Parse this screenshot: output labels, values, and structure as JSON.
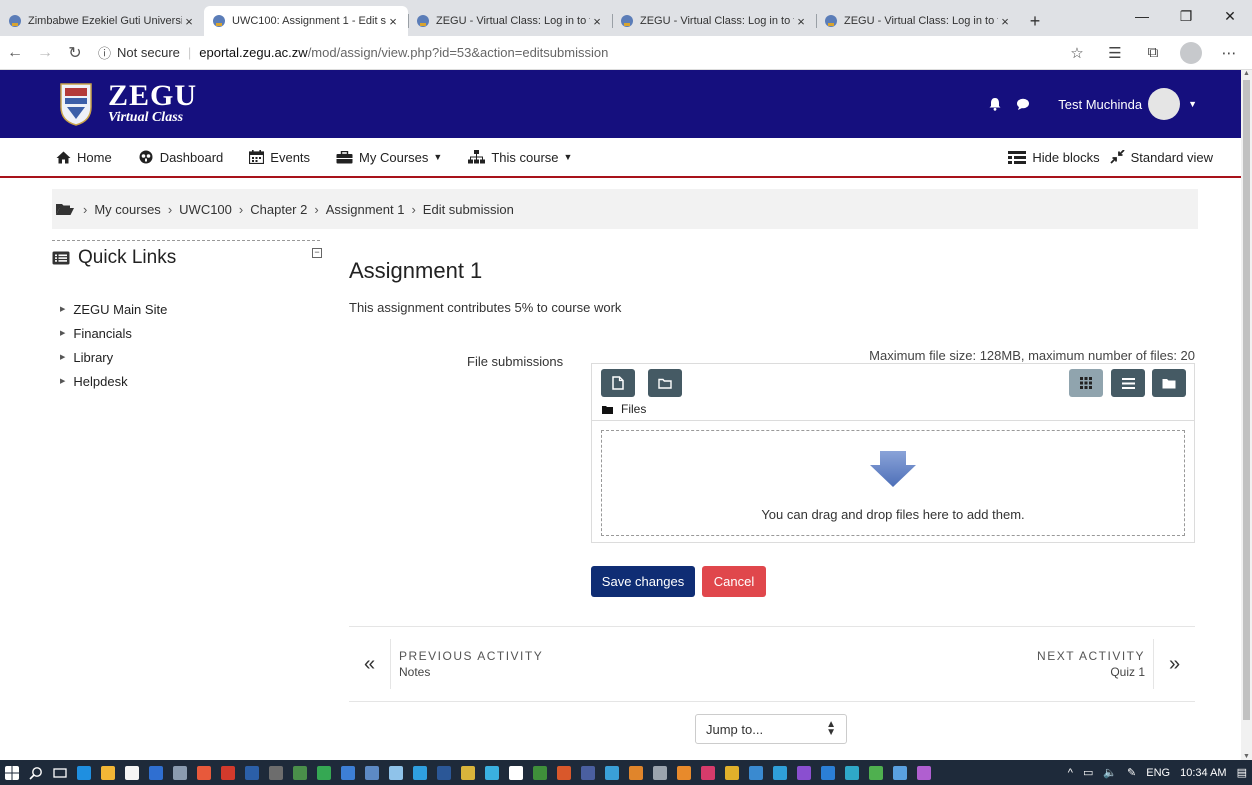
{
  "browser": {
    "tabs": [
      {
        "label": "Zimbabwe Ezekiel Guti University",
        "active": false
      },
      {
        "label": "UWC100: Assignment 1 - Edit sub",
        "active": true
      },
      {
        "label": "ZEGU - Virtual Class: Log in to th",
        "active": false
      },
      {
        "label": "ZEGU - Virtual Class: Log in to th",
        "active": false
      },
      {
        "label": "ZEGU - Virtual Class: Log in to th",
        "active": false
      }
    ],
    "tab_close": "×",
    "new_tab": "+",
    "window_controls": {
      "minimize": "—",
      "restore": "❐",
      "close": "✕"
    },
    "security_label": "Not secure",
    "url_host": "eportal.zegu.ac.zw",
    "url_path": "/mod/assign/view.php?id=53&action=editsubmission"
  },
  "header": {
    "brand_name": "ZEGU",
    "brand_sub": "Virtual Class",
    "user_name": "Test Muchinda"
  },
  "nav": {
    "items": [
      {
        "label": "Home",
        "icon": "home-icon"
      },
      {
        "label": "Dashboard",
        "icon": "dashboard-icon"
      },
      {
        "label": "Events",
        "icon": "calendar-icon"
      },
      {
        "label": "My Courses",
        "icon": "briefcase-icon"
      },
      {
        "label": "This course",
        "icon": "sitemap-icon"
      }
    ],
    "hide_blocks": "Hide blocks",
    "standard_view": "Standard view"
  },
  "breadcrumb": [
    "My courses",
    "UWC100",
    "Chapter 2",
    "Assignment 1",
    "Edit submission"
  ],
  "quick_links": {
    "title": "Quick Links",
    "items": [
      "ZEGU Main Site",
      "Financials",
      "Library",
      "Helpdesk"
    ]
  },
  "main": {
    "title": "Assignment 1",
    "description": "This assignment contributes 5% to course work",
    "file_label": "File submissions",
    "max_info": "Maximum file size: 128MB, maximum number of files: 20",
    "files_label": "Files",
    "drop_text": "You can drag and drop files here to add them.",
    "save_label": "Save changes",
    "cancel_label": "Cancel"
  },
  "activity_nav": {
    "prev_caption": "PREVIOUS ACTIVITY",
    "prev_name": "Notes",
    "next_caption": "NEXT ACTIVITY",
    "next_name": "Quiz 1"
  },
  "jump": {
    "placeholder": "Jump to..."
  },
  "taskbar": {
    "lang": "ENG",
    "time": "10:34 AM"
  },
  "colors": {
    "header_bg": "#150f7e",
    "nav_underline": "#a8121a",
    "save_button": "#0f2d74",
    "cancel_button": "#e0474c",
    "filepicker_button": "#455a64"
  }
}
